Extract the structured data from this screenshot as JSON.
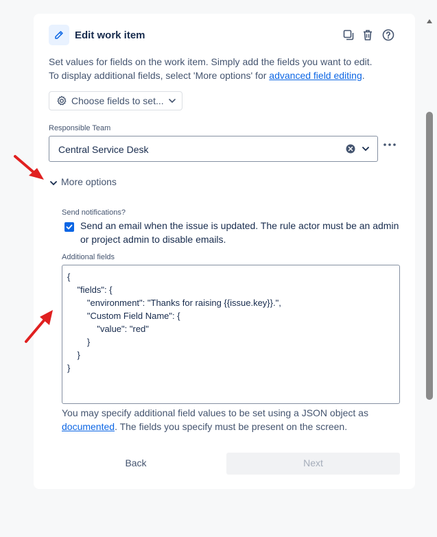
{
  "header": {
    "title": "Edit work item",
    "icon": "edit-icon",
    "actions": [
      "copy-icon",
      "trash-icon",
      "help-icon"
    ]
  },
  "description": {
    "line1": "Set values for fields on the work item. Simply add the fields you want to edit.",
    "line2_prefix": "To display additional fields, select 'More options' for ",
    "line2_link": "advanced field editing",
    "line2_suffix": "."
  },
  "choose_fields": {
    "label": "Choose fields to set...",
    "icon": "gear-icon"
  },
  "responsible_team": {
    "label": "Responsible Team",
    "value": "Central Service Desk"
  },
  "more_options": {
    "label": "More options",
    "expanded": true
  },
  "notifications": {
    "label": "Send notifications?",
    "checkbox_text_line1": "Send an email when the issue is updated. The rule actor must be an admin",
    "checkbox_text_line2": "or project admin to disable emails.",
    "checked": true
  },
  "additional_fields": {
    "label": "Additional fields",
    "json_lines": [
      "{",
      "    \"fields\": {",
      "        \"environment\": \"Thanks for raising {{issue.key}}.\",",
      "        \"Custom Field Name\": {",
      "            \"value\": \"red\"",
      "        }",
      "    }",
      "}"
    ]
  },
  "help": {
    "line1": "You may specify additional field values to be set using a JSON object as",
    "link": "documented",
    "line2_suffix": ". The fields you specify must be present on the screen."
  },
  "footer": {
    "back_label": "Back",
    "next_label": "Next"
  },
  "colors": {
    "accent": "#0c66e4",
    "annotation_arrow": "#e02020",
    "background": "#f7f8f9"
  }
}
